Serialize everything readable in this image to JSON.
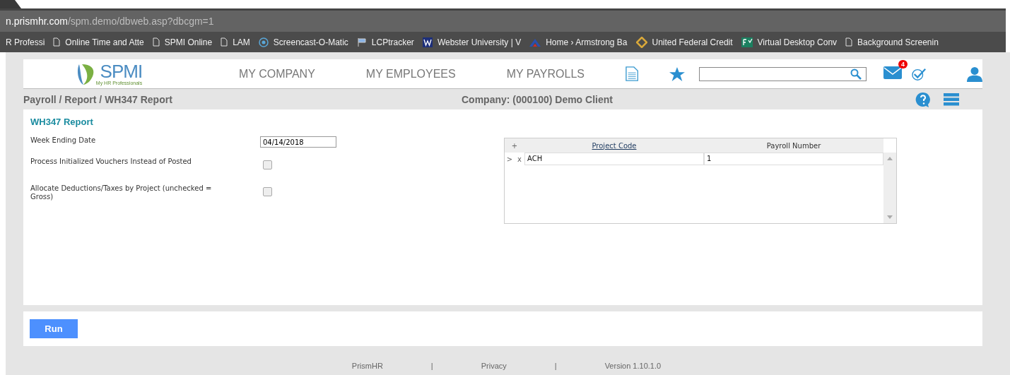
{
  "browser": {
    "url_host": "n.prismhr.com",
    "url_path": "/spm.demo/dbweb.asp?dbcgm=1",
    "bookmarks": [
      {
        "kind": "none",
        "label": "R Professi"
      },
      {
        "kind": "page",
        "label": "Online Time and Atte"
      },
      {
        "kind": "page",
        "label": "SPMI Online"
      },
      {
        "kind": "page",
        "label": "LAM"
      },
      {
        "kind": "record",
        "label": "Screencast-O-Matic"
      },
      {
        "kind": "flag",
        "label": "LCPtracker"
      },
      {
        "kind": "letter",
        "label": "Webster University | V"
      },
      {
        "kind": "chevron",
        "label": "Home › Armstrong Ba"
      },
      {
        "kind": "diamond",
        "label": "United Federal Credit"
      },
      {
        "kind": "sheet",
        "label": "Virtual Desktop Conv"
      },
      {
        "kind": "page",
        "label": "Background Screenin"
      }
    ]
  },
  "header": {
    "logo_text": "SPMI",
    "logo_tagline": "My HR Professionals",
    "nav": [
      "MY COMPANY",
      "MY EMPLOYEES",
      "MY PAYROLLS"
    ],
    "mail_badge": "4"
  },
  "breadcrumb": "Payroll / Report / WH347 Report",
  "company": "Company: (000100) Demo Client",
  "form": {
    "title": "WH347 Report",
    "fields": [
      {
        "kind": "text",
        "label": "Week Ending Date",
        "value": "04/14/2018"
      },
      {
        "kind": "checkbox",
        "label": "Process Initialized Vouchers Instead of Posted",
        "checked": false
      },
      {
        "kind": "checkbox",
        "label": "Allocate Deductions/Taxes by Project (unchecked = Gross)",
        "checked": false
      }
    ],
    "grid": {
      "add": "+",
      "columns": [
        "Project Code",
        "Payroll Number"
      ],
      "rows": [
        {
          "pointer": ">",
          "delete": "x",
          "cells": [
            "ACH",
            "1"
          ]
        }
      ]
    }
  },
  "run_button": "Run",
  "footer": [
    "PrismHR",
    "|",
    "Privacy",
    "|",
    "Version 1.10.1.0"
  ]
}
